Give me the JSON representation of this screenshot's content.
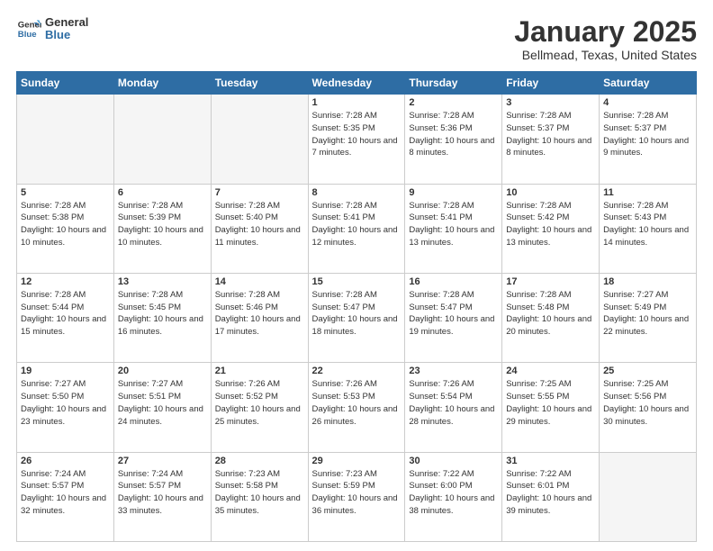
{
  "header": {
    "logo_line1": "General",
    "logo_line2": "Blue",
    "title": "January 2025",
    "subtitle": "Bellmead, Texas, United States"
  },
  "weekdays": [
    "Sunday",
    "Monday",
    "Tuesday",
    "Wednesday",
    "Thursday",
    "Friday",
    "Saturday"
  ],
  "weeks": [
    [
      {
        "day": "",
        "empty": true
      },
      {
        "day": "",
        "empty": true
      },
      {
        "day": "",
        "empty": true
      },
      {
        "day": "1",
        "sunrise": "7:28 AM",
        "sunset": "5:35 PM",
        "daylight": "10 hours and 7 minutes."
      },
      {
        "day": "2",
        "sunrise": "7:28 AM",
        "sunset": "5:36 PM",
        "daylight": "10 hours and 8 minutes."
      },
      {
        "day": "3",
        "sunrise": "7:28 AM",
        "sunset": "5:37 PM",
        "daylight": "10 hours and 8 minutes."
      },
      {
        "day": "4",
        "sunrise": "7:28 AM",
        "sunset": "5:37 PM",
        "daylight": "10 hours and 9 minutes."
      }
    ],
    [
      {
        "day": "5",
        "sunrise": "7:28 AM",
        "sunset": "5:38 PM",
        "daylight": "10 hours and 10 minutes."
      },
      {
        "day": "6",
        "sunrise": "7:28 AM",
        "sunset": "5:39 PM",
        "daylight": "10 hours and 10 minutes."
      },
      {
        "day": "7",
        "sunrise": "7:28 AM",
        "sunset": "5:40 PM",
        "daylight": "10 hours and 11 minutes."
      },
      {
        "day": "8",
        "sunrise": "7:28 AM",
        "sunset": "5:41 PM",
        "daylight": "10 hours and 12 minutes."
      },
      {
        "day": "9",
        "sunrise": "7:28 AM",
        "sunset": "5:41 PM",
        "daylight": "10 hours and 13 minutes."
      },
      {
        "day": "10",
        "sunrise": "7:28 AM",
        "sunset": "5:42 PM",
        "daylight": "10 hours and 13 minutes."
      },
      {
        "day": "11",
        "sunrise": "7:28 AM",
        "sunset": "5:43 PM",
        "daylight": "10 hours and 14 minutes."
      }
    ],
    [
      {
        "day": "12",
        "sunrise": "7:28 AM",
        "sunset": "5:44 PM",
        "daylight": "10 hours and 15 minutes."
      },
      {
        "day": "13",
        "sunrise": "7:28 AM",
        "sunset": "5:45 PM",
        "daylight": "10 hours and 16 minutes."
      },
      {
        "day": "14",
        "sunrise": "7:28 AM",
        "sunset": "5:46 PM",
        "daylight": "10 hours and 17 minutes."
      },
      {
        "day": "15",
        "sunrise": "7:28 AM",
        "sunset": "5:47 PM",
        "daylight": "10 hours and 18 minutes."
      },
      {
        "day": "16",
        "sunrise": "7:28 AM",
        "sunset": "5:47 PM",
        "daylight": "10 hours and 19 minutes."
      },
      {
        "day": "17",
        "sunrise": "7:28 AM",
        "sunset": "5:48 PM",
        "daylight": "10 hours and 20 minutes."
      },
      {
        "day": "18",
        "sunrise": "7:27 AM",
        "sunset": "5:49 PM",
        "daylight": "10 hours and 22 minutes."
      }
    ],
    [
      {
        "day": "19",
        "sunrise": "7:27 AM",
        "sunset": "5:50 PM",
        "daylight": "10 hours and 23 minutes."
      },
      {
        "day": "20",
        "sunrise": "7:27 AM",
        "sunset": "5:51 PM",
        "daylight": "10 hours and 24 minutes."
      },
      {
        "day": "21",
        "sunrise": "7:26 AM",
        "sunset": "5:52 PM",
        "daylight": "10 hours and 25 minutes."
      },
      {
        "day": "22",
        "sunrise": "7:26 AM",
        "sunset": "5:53 PM",
        "daylight": "10 hours and 26 minutes."
      },
      {
        "day": "23",
        "sunrise": "7:26 AM",
        "sunset": "5:54 PM",
        "daylight": "10 hours and 28 minutes."
      },
      {
        "day": "24",
        "sunrise": "7:25 AM",
        "sunset": "5:55 PM",
        "daylight": "10 hours and 29 minutes."
      },
      {
        "day": "25",
        "sunrise": "7:25 AM",
        "sunset": "5:56 PM",
        "daylight": "10 hours and 30 minutes."
      }
    ],
    [
      {
        "day": "26",
        "sunrise": "7:24 AM",
        "sunset": "5:57 PM",
        "daylight": "10 hours and 32 minutes."
      },
      {
        "day": "27",
        "sunrise": "7:24 AM",
        "sunset": "5:57 PM",
        "daylight": "10 hours and 33 minutes."
      },
      {
        "day": "28",
        "sunrise": "7:23 AM",
        "sunset": "5:58 PM",
        "daylight": "10 hours and 35 minutes."
      },
      {
        "day": "29",
        "sunrise": "7:23 AM",
        "sunset": "5:59 PM",
        "daylight": "10 hours and 36 minutes."
      },
      {
        "day": "30",
        "sunrise": "7:22 AM",
        "sunset": "6:00 PM",
        "daylight": "10 hours and 38 minutes."
      },
      {
        "day": "31",
        "sunrise": "7:22 AM",
        "sunset": "6:01 PM",
        "daylight": "10 hours and 39 minutes."
      },
      {
        "day": "",
        "empty": true
      }
    ]
  ]
}
